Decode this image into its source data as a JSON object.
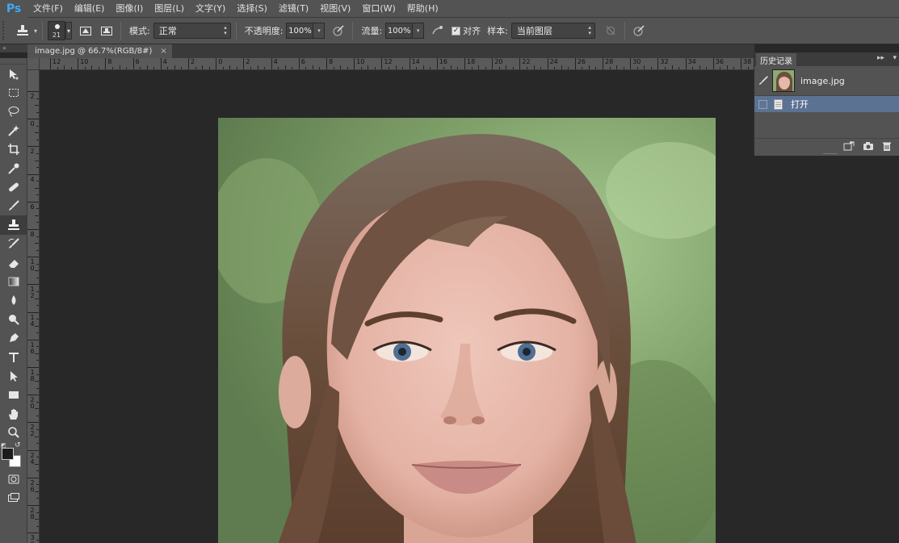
{
  "app": {
    "logo": "Ps"
  },
  "menu": [
    "文件(F)",
    "编辑(E)",
    "图像(I)",
    "图层(L)",
    "文字(Y)",
    "选择(S)",
    "滤镜(T)",
    "视图(V)",
    "窗口(W)",
    "帮助(H)"
  ],
  "options": {
    "brush_size": "21",
    "mode_label": "模式:",
    "mode_value": "正常",
    "opacity_label": "不透明度:",
    "opacity_value": "100%",
    "flow_label": "流量:",
    "flow_value": "100%",
    "aligned_label": "对齐",
    "aligned_checked": true,
    "sample_label": "样本:",
    "sample_value": "当前图层"
  },
  "document": {
    "tab_label": "image.jpg @ 66.7%(RGB/8#)",
    "close": "×"
  },
  "ruler": {
    "top_labels": [
      "12",
      "10",
      "8",
      "6",
      "4",
      "2",
      "0",
      "2",
      "4",
      "6",
      "8",
      "10",
      "12",
      "14",
      "16",
      "18",
      "20",
      "22",
      "24",
      "26",
      "28",
      "30",
      "32",
      "34",
      "36",
      "38"
    ],
    "left_labels": [
      "2",
      "0",
      "2",
      "4",
      "6",
      "8",
      "10",
      "12",
      "14",
      "16",
      "18",
      "20",
      "22",
      "24",
      "26",
      "28",
      "30"
    ]
  },
  "tools": [
    "move-tool",
    "marquee-tool",
    "lasso-tool",
    "quick-select-tool",
    "crop-tool",
    "eyedropper-tool",
    "healing-brush-tool",
    "brush-tool",
    "clone-stamp-tool",
    "history-brush-tool",
    "eraser-tool",
    "gradient-tool",
    "blur-tool",
    "dodge-tool",
    "pen-tool",
    "type-tool",
    "path-select-tool",
    "shape-tool",
    "hand-tool",
    "zoom-tool"
  ],
  "history": {
    "tab_label": "历史记录",
    "snapshot_name": "image.jpg",
    "states": [
      {
        "label": "打开",
        "selected": true
      }
    ]
  },
  "colors": {
    "selection": "#5b7293",
    "panel": "#535353",
    "canvas_bg": "#282828"
  }
}
